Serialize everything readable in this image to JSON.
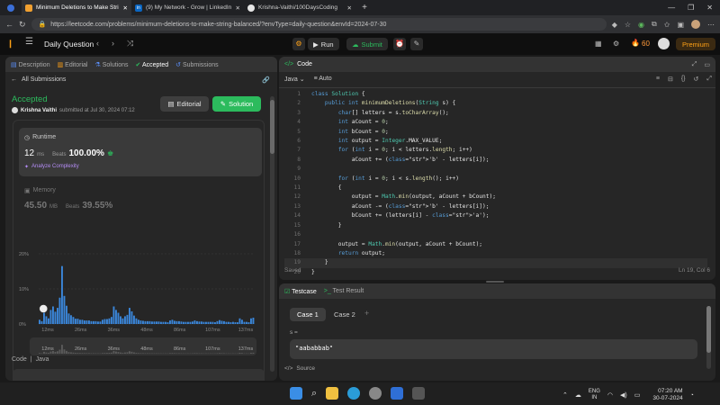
{
  "browser": {
    "tabs": [
      {
        "label": "Minimum Deletions to Make Stri",
        "icon": "leetcode-icon",
        "active": true
      },
      {
        "label": "(9) My Network - Grow | LinkedIn",
        "icon": "linkedin-icon",
        "active": false
      },
      {
        "label": "Krishna-Vaithi/100DaysCoding",
        "icon": "github-icon",
        "active": false
      }
    ],
    "url": "https://leetcode.com/problems/minimum-deletions-to-make-string-balanced/?envType=daily-question&envId=2024-07-30"
  },
  "header": {
    "title": "Daily Question",
    "run": "Run",
    "submit": "Submit",
    "streak": "60",
    "premium": "Premium"
  },
  "left": {
    "tabs": [
      "Description",
      "Editorial",
      "Solutions",
      "Accepted",
      "Submissions"
    ],
    "all_submissions": "All Submissions",
    "status": "Accepted",
    "user": "Krishna Vaithi",
    "submitted": "submitted at Jul 30, 2024 07:12",
    "editorial_btn": "Editorial",
    "solution_btn": "Solution",
    "runtime_label": "Runtime",
    "runtime_value": "12",
    "runtime_unit": "ms",
    "beats_label": "Beats",
    "runtime_beats": "100.00%",
    "analyze": "Analyze Complexity",
    "memory_label": "Memory",
    "memory_value": "45.50",
    "memory_unit": "MB",
    "memory_beats": "39.55%",
    "code_label": "Code",
    "lang": "Java"
  },
  "chart_data": {
    "type": "bar",
    "ylabels": [
      "20%",
      "10%",
      "0%"
    ],
    "ylim": [
      0,
      20
    ],
    "xticks": [
      "12ms",
      "26ms",
      "36ms",
      "48ms",
      "86ms",
      "107ms",
      "137ms"
    ],
    "values": [
      1.2,
      0.8,
      3.5,
      2.2,
      1.6,
      4,
      5,
      3.5,
      4.6,
      7.5,
      16.5,
      8,
      5.2,
      3,
      2.5,
      2,
      1.5,
      1.5,
      1.2,
      1.2,
      1,
      1,
      1,
      0.8,
      0.8,
      0.8,
      0.7,
      0.7,
      1.2,
      1.4,
      1.4,
      1.6,
      2,
      5,
      4,
      3.2,
      2.2,
      1.6,
      2.2,
      2.6,
      4.6,
      3.6,
      2.4,
      1.6,
      1.2,
      1,
      0.9,
      0.8,
      0.8,
      0.8,
      0.7,
      0.7,
      0.7,
      0.7,
      0.6,
      0.6,
      0.6,
      0.5,
      1,
      1.2,
      0.9,
      0.8,
      0.8,
      0.7,
      0.6,
      0.6,
      0.6,
      0.6,
      0.7,
      1,
      0.8,
      0.7,
      0.7,
      0.6,
      0.6,
      0.6,
      0.6,
      0.6,
      0.5,
      0.8,
      1.1,
      0.9,
      0.8,
      0.6,
      0.6,
      0.5,
      0.6,
      0.5,
      0.5,
      1.6,
      1.2,
      0.6,
      0.6,
      0.5,
      1.6,
      1.8
    ],
    "highlight_index": 0
  },
  "right": {
    "title": "Code",
    "lang": "Java",
    "auto": "Auto",
    "code": [
      "class Solution {",
      "    public int minimumDeletions(String s) {",
      "        char[] letters = s.toCharArray();",
      "        int aCount = 0;",
      "        int bCount = 0;",
      "        int output = Integer.MAX_VALUE;",
      "        for (int i = 0; i < letters.length; i++)",
      "            aCount += ('b' - letters[i]);",
      "",
      "        for (int i = 0; i < s.length(); i++)",
      "        {",
      "            output = Math.min(output, aCount + bCount);",
      "            aCount -= ('b' - letters[i]);",
      "            bCount += (letters[i] - 'a');",
      "        }",
      "",
      "        output = Math.min(output, aCount + bCount);",
      "        return output;",
      "    }",
      "}"
    ],
    "saved": "Saved",
    "cursor": "Ln 19, Col 6",
    "testcase_tab": "Testcase",
    "result_tab": "Test Result",
    "cases": [
      "Case 1",
      "Case 2"
    ],
    "var_name": "s =",
    "var_value": "\"aababbab\"",
    "source": "Source"
  },
  "taskbar": {
    "lang1": "ENG",
    "lang2": "IN",
    "time": "07:20 AM",
    "date": "30-07-2024"
  }
}
